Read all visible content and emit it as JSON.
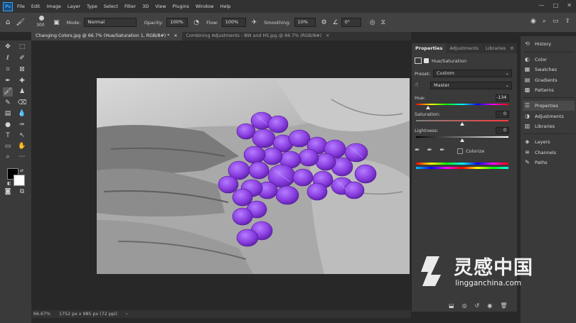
{
  "app": {
    "logo": "Ps"
  },
  "menu": [
    "File",
    "Edit",
    "Image",
    "Layer",
    "Type",
    "Select",
    "Filter",
    "3D",
    "View",
    "Plugins",
    "Window",
    "Help"
  ],
  "window_controls": [
    "—",
    "□",
    "✕"
  ],
  "options": {
    "brush_size": "300",
    "mode_label": "Mode:",
    "mode_value": "Normal",
    "opacity_label": "Opacity:",
    "opacity_value": "100%",
    "flow_label": "Flow:",
    "flow_value": "100%",
    "smoothing_label": "Smoothing:",
    "smoothing_value": "10%",
    "angle_value": "0°"
  },
  "tabs": [
    {
      "label": "Changing Colors.jpg @ 66.7% (Hue/Saturation 1, RGB/8#) *",
      "close": "×"
    },
    {
      "label": "Combining Adjustments - BW and HS.jpg @ 66.7% (RGB/8#)",
      "close": "×"
    }
  ],
  "status": {
    "zoom": "66.67%",
    "info": "1752 px x 985 px (72 ppi)",
    "arrow": "›"
  },
  "properties": {
    "tabs": [
      "Properties",
      "Adjustments",
      "Libraries"
    ],
    "title": "Hue/Saturation",
    "preset_label": "Preset:",
    "preset_value": "Custom",
    "channel_value": "Master",
    "hue_label": "Hue:",
    "hue_value": "-134",
    "hue_level": 0.128,
    "saturation_label": "Saturation:",
    "saturation_value": "0",
    "saturation_level": 0.5,
    "lightness_label": "Lightness:",
    "lightness_value": "0",
    "lightness_level": 0.5,
    "colorize_label": "Colorize"
  },
  "dock": [
    {
      "label": "History",
      "icon": "history-icon",
      "glyph": "⟲"
    },
    {
      "label": "Color",
      "icon": "color-icon",
      "glyph": "◐"
    },
    {
      "label": "Swatches",
      "icon": "swatches-icon",
      "glyph": "▦"
    },
    {
      "label": "Gradients",
      "icon": "gradients-icon",
      "glyph": "▤"
    },
    {
      "label": "Patterns",
      "icon": "patterns-icon",
      "glyph": "▩"
    },
    {
      "label": "Properties",
      "icon": "properties-icon",
      "glyph": "☰"
    },
    {
      "label": "Adjustments",
      "icon": "adjustments-icon",
      "glyph": "◑"
    },
    {
      "label": "Libraries",
      "icon": "libraries-icon",
      "glyph": "▥"
    },
    {
      "label": "Layers",
      "icon": "layers-icon",
      "glyph": "◈"
    },
    {
      "label": "Channels",
      "icon": "channels-icon",
      "glyph": "≋"
    },
    {
      "label": "Paths",
      "icon": "paths-icon",
      "glyph": "✎"
    }
  ],
  "watermark": {
    "cn": "灵感中国",
    "url": "lingganchina.com"
  },
  "colors": {
    "accent": "#31a8ff",
    "pill": "#8a3fe0",
    "pill_light": "#a866f5",
    "fg_swatch": "#000000",
    "bg_swatch": "#ffffff"
  }
}
